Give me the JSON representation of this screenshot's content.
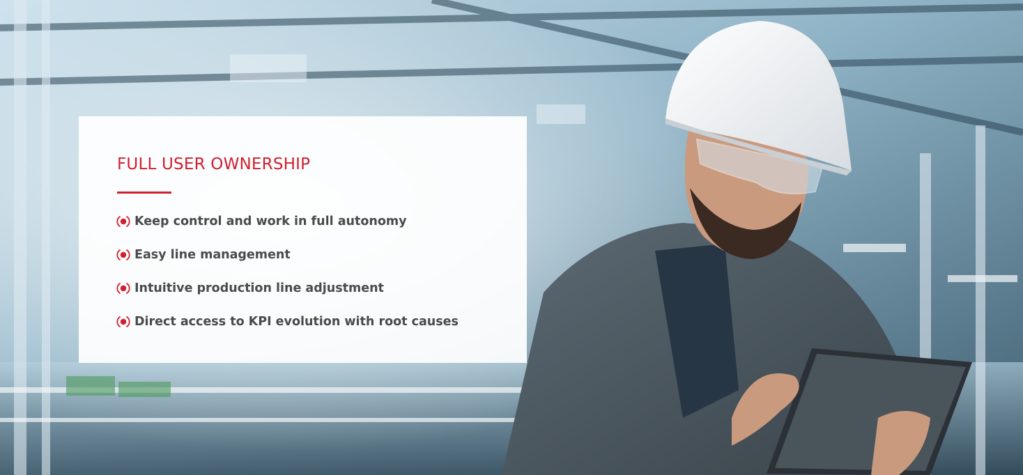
{
  "colors": {
    "accent": "#d01f2d",
    "text": "#4a4a4a",
    "card_background": "#ffffff"
  },
  "hero": {
    "image_subject": "engineer-with-hard-hat-using-tablet-in-factory"
  },
  "card": {
    "title": "FULL USER OWNERSHIP",
    "bullet_icon": "radio-signal-icon",
    "features": [
      {
        "label": "Keep control and work in full autonomy"
      },
      {
        "label": "Easy line management"
      },
      {
        "label": "Intuitive production line adjustment"
      },
      {
        "label": "Direct access to KPI evolution with root causes"
      }
    ]
  }
}
